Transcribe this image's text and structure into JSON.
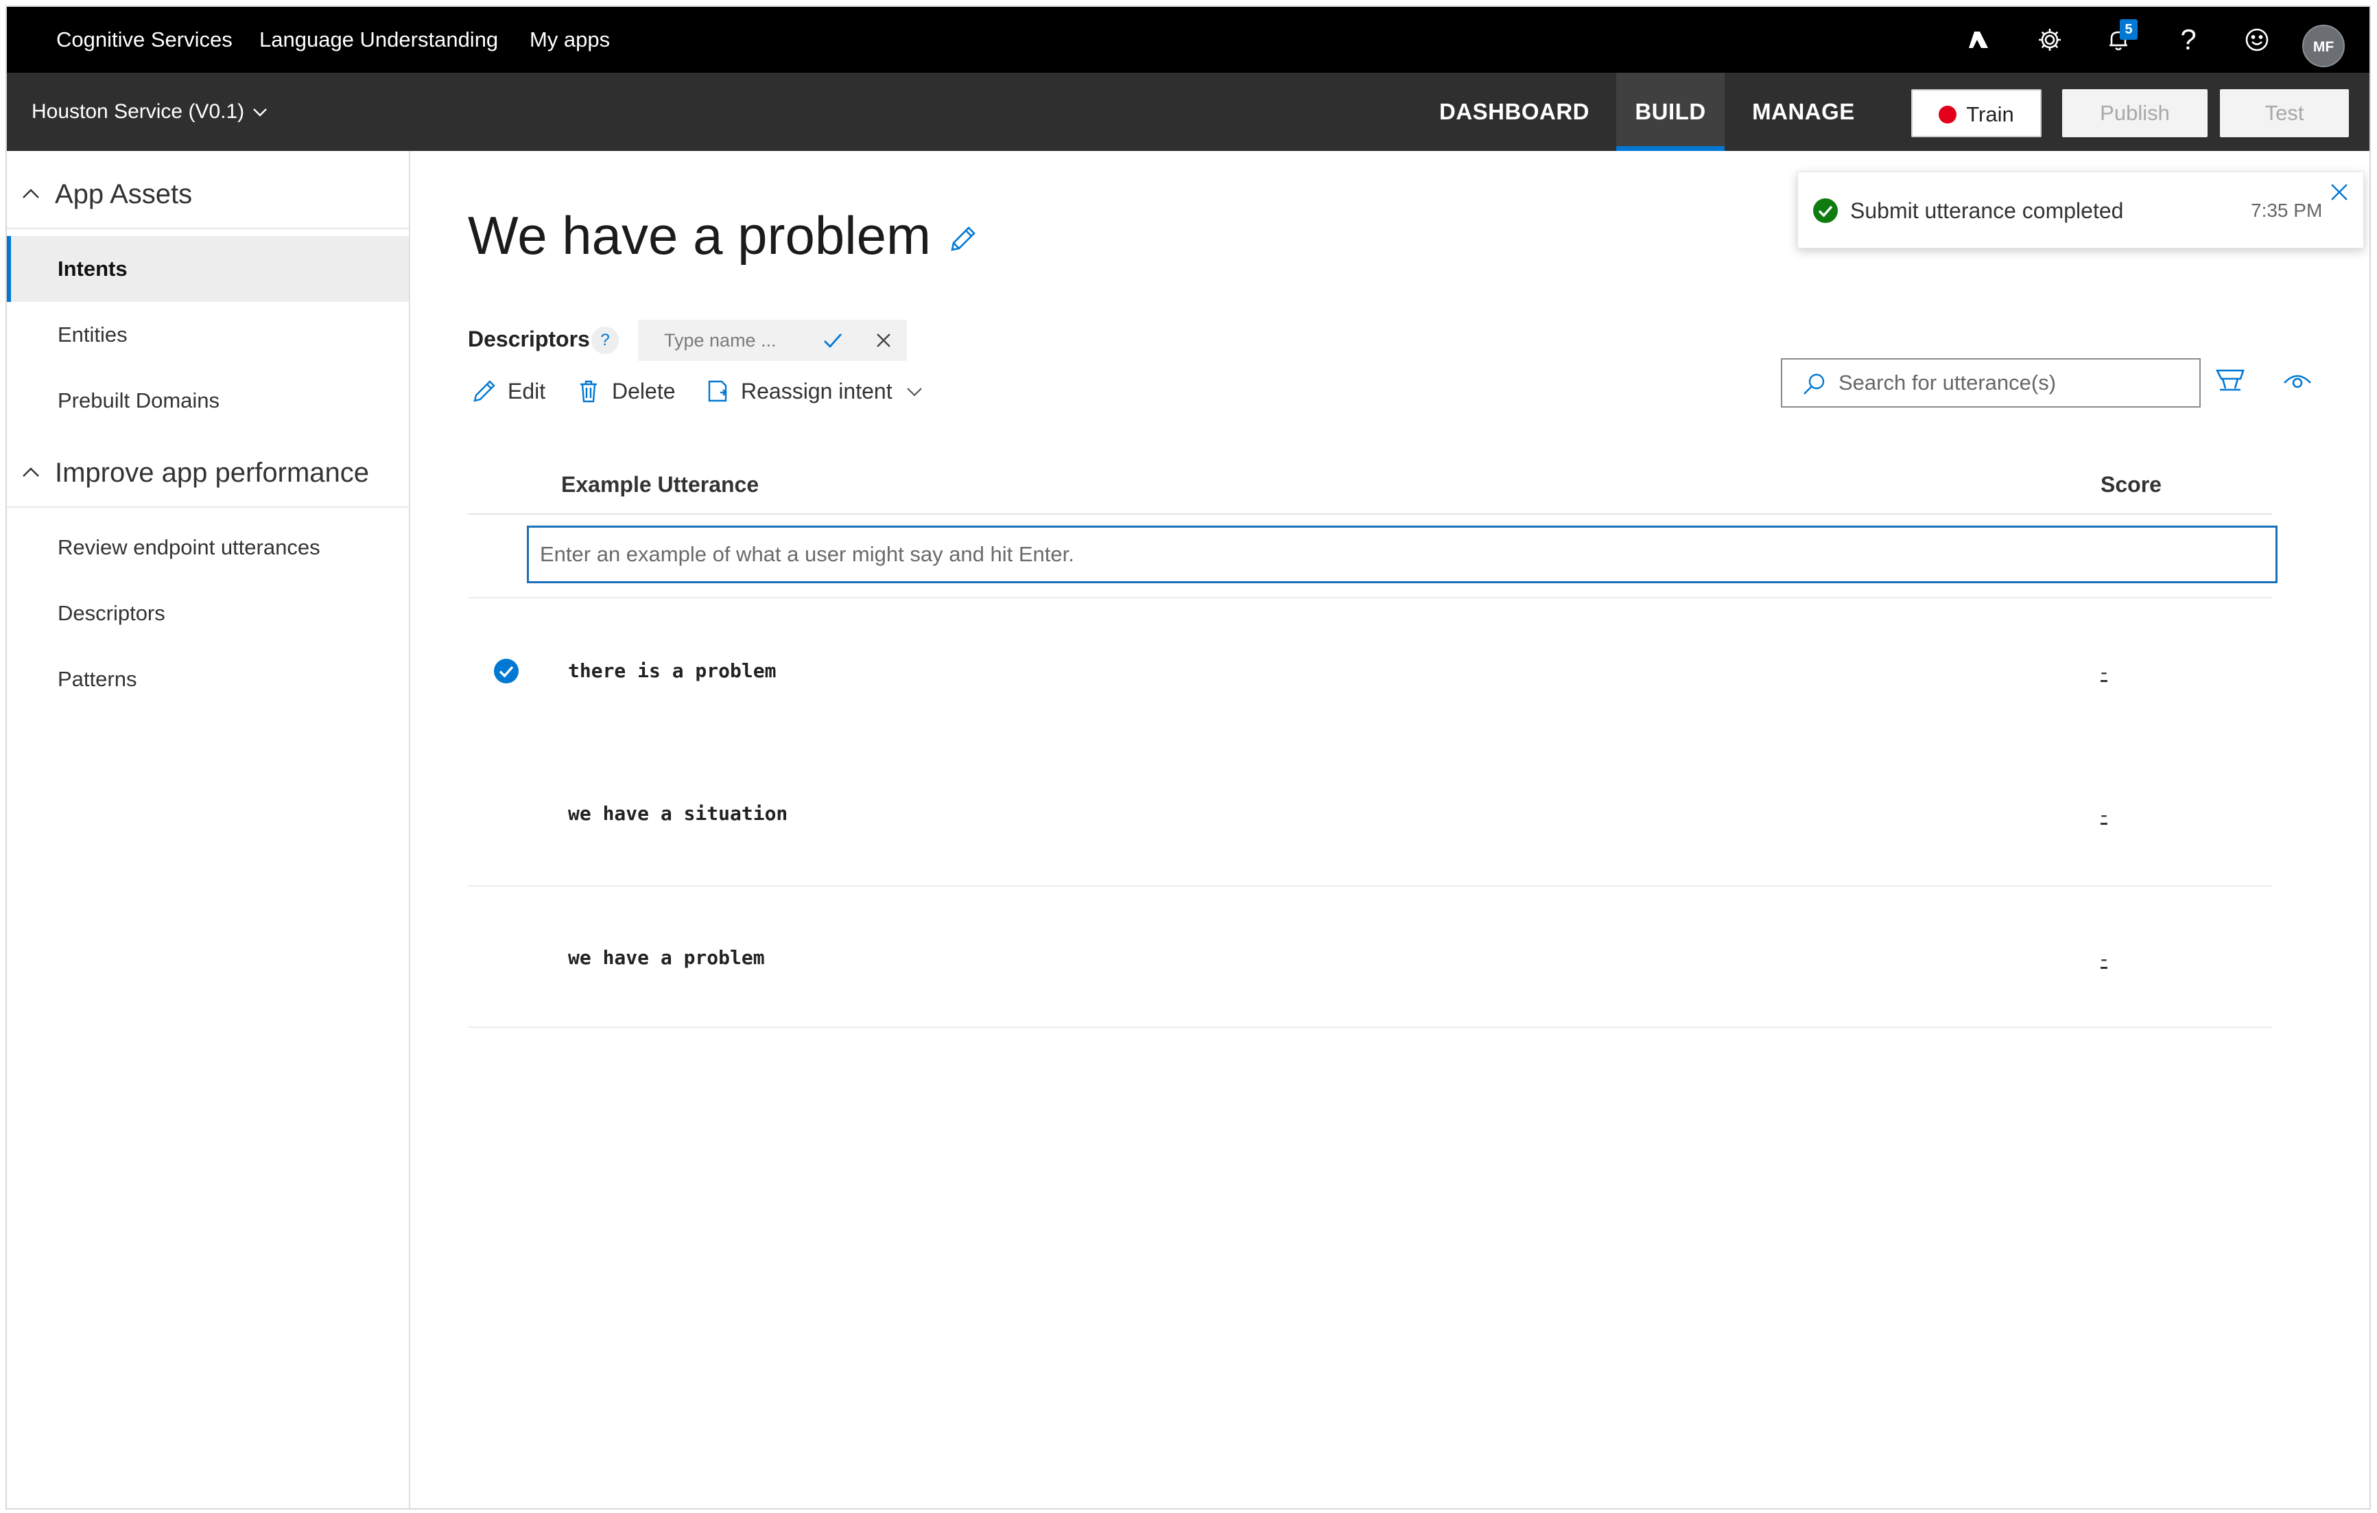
{
  "topbar": {
    "breadcrumbs": [
      "Cognitive Services",
      "Language Understanding",
      "My apps"
    ],
    "icons": [
      "azure-icon",
      "gear-icon",
      "bell-icon",
      "help-icon",
      "smiley-icon"
    ],
    "help_glyph": "?",
    "notification_count": "5",
    "avatar_initials": "MF"
  },
  "appbar": {
    "app_name": "Houston Service (V0.1)",
    "tabs": [
      {
        "label": "DASHBOARD",
        "active": false
      },
      {
        "label": "BUILD",
        "active": true
      },
      {
        "label": "MANAGE",
        "active": false
      }
    ],
    "train_label": "Train",
    "publish_label": "Publish",
    "test_label": "Test"
  },
  "sidebar": {
    "sections": [
      {
        "title": "App Assets",
        "items": [
          "Intents",
          "Entities",
          "Prebuilt Domains"
        ]
      },
      {
        "title": "Improve app performance",
        "items": [
          "Review endpoint utterances",
          "Descriptors",
          "Patterns"
        ]
      }
    ],
    "active_item": "Intents"
  },
  "main": {
    "title": "We have a problem",
    "descriptors_label": "Descriptors",
    "descriptors_help": "?",
    "descriptor_placeholder": "Type name ...",
    "actions": {
      "edit": "Edit",
      "delete": "Delete",
      "reassign": "Reassign intent"
    },
    "search_placeholder": "Search for utterance(s)",
    "columns": {
      "utterance": "Example Utterance",
      "score": "Score"
    },
    "utterance_placeholder": "Enter an example of what a user might say and hit Enter.",
    "utterances": [
      {
        "text": "there is a problem",
        "score": "-",
        "checked": true
      },
      {
        "text": "we have a situation",
        "score": "-",
        "checked": false
      },
      {
        "text": "we have a problem",
        "score": "-",
        "checked": false
      }
    ]
  },
  "toast": {
    "message": "Submit utterance completed",
    "time": "7:35 PM"
  },
  "colors": {
    "accent": "#0078d4",
    "topbar_bg": "#000000",
    "appbar_bg": "#2f2f2f",
    "train_dot": "#e3001b",
    "success": "#107c10"
  }
}
